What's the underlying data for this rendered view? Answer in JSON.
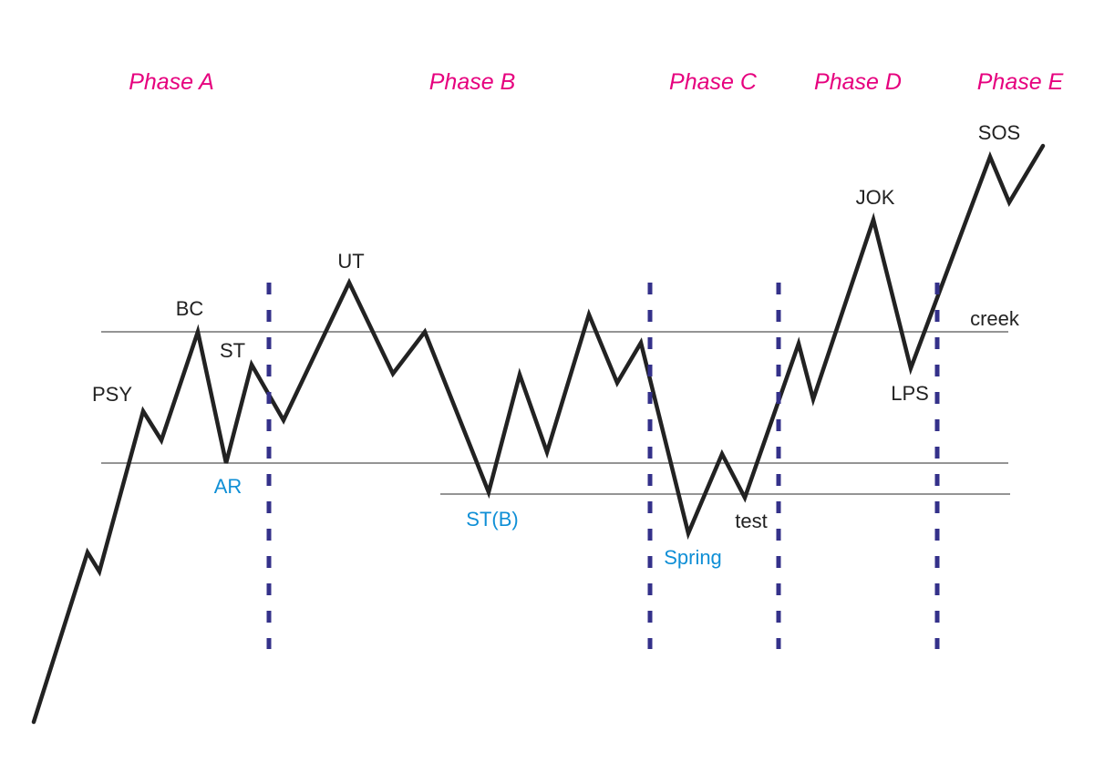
{
  "colors": {
    "phase": "#e6007e",
    "event_dark": "#222222",
    "event_blue": "#0f8fd6",
    "price_line": "#222222",
    "level_line": "#555555",
    "phase_divider": "#34318a"
  },
  "phases": [
    "Phase A",
    "Phase B",
    "Phase C",
    "Phase D",
    "Phase E"
  ],
  "events": {
    "psy": "PSY",
    "bc": "BC",
    "st": "ST",
    "ar": "AR",
    "ut": "UT",
    "stb": "ST(B)",
    "spring": "Spring",
    "test": "test",
    "jok": "JOK",
    "lps": "LPS",
    "creek": "creek",
    "sos": "SOS"
  }
}
